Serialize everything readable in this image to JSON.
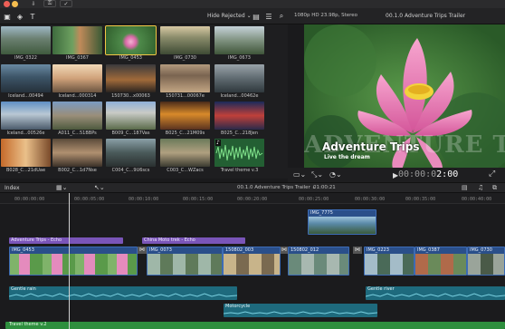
{
  "browser": {
    "filter_label": "Hide Rejected",
    "clips": [
      {
        "label": "IMG_0322"
      },
      {
        "label": "IMG_0367"
      },
      {
        "label": "IMG_0453"
      },
      {
        "label": "IMG_0730"
      },
      {
        "label": "IMG_0673"
      },
      {
        "label": "Iceland...00494"
      },
      {
        "label": "Iceland...000314"
      },
      {
        "label": "150730...x00063"
      },
      {
        "label": "150731...00067e"
      },
      {
        "label": "Iceland...00462e"
      },
      {
        "label": "Iceland...00526e"
      },
      {
        "label": "A011_C...51BBPs"
      },
      {
        "label": "B009_C...187Vas"
      },
      {
        "label": "B025_C...21M09s"
      },
      {
        "label": "B025_C...218Jen"
      },
      {
        "label": "B028_C...21dUae"
      },
      {
        "label": "B002_C...1d7Nse"
      },
      {
        "label": "C004_C...9U6scs"
      },
      {
        "label": "C003_C...WZacs"
      },
      {
        "label": "Travel theme v.3"
      }
    ]
  },
  "viewer": {
    "format": "1080p HD 23.98p, Stereo",
    "title": "00.1.0 Adventure Trips Trailer",
    "overlay_bg": "ADVENTURE TRIPS",
    "overlay_title": "Adventure Trips",
    "overlay_sub": "Live the dream",
    "timecode_dim": "00:00:0",
    "timecode_bright": "2:00"
  },
  "timeline_bar": {
    "index_label": "Index",
    "project": "00.1.0 Adventure Trips Trailer",
    "duration": "01:00:21"
  },
  "ruler": [
    "00:00:00:00",
    "00:00:05:00",
    "00:00:10:00",
    "00:00:15:00",
    "00:00:20:00",
    "00:00:25:00",
    "00:00:30:00",
    "00:00:35:00",
    "00:00:40:00"
  ],
  "timeline": {
    "titles": [
      {
        "label": "Adventure Trips - Echo"
      },
      {
        "label": "China Moto trek - Echo"
      }
    ],
    "connected": {
      "label": "IMG_7775"
    },
    "primary": [
      {
        "label": "IMG_0453"
      },
      {
        "label": "IMG_0073"
      },
      {
        "label": "150802_003"
      },
      {
        "label": "150802_012"
      },
      {
        "label": "IMG_0223"
      },
      {
        "label": "IMG_0387"
      },
      {
        "label": "IMG_0730"
      }
    ],
    "audio": [
      {
        "label": "Gentle rain"
      },
      {
        "label": "Gentle river"
      },
      {
        "label": "Motorcycle"
      }
    ],
    "music": {
      "label": "Travel theme v.2"
    }
  },
  "colors": {
    "title_clip": "#7a55b8",
    "video_clip": "#2a4f8a",
    "audio_clip": "#1e6a7d",
    "music_clip": "#2e8f3e",
    "selection": "#f2c644"
  }
}
